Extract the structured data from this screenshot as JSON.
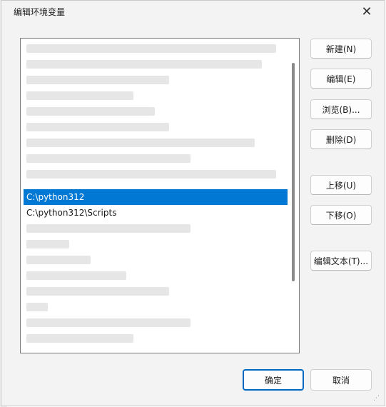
{
  "dialog": {
    "title": "编辑环境变量",
    "close_glyph": "✕"
  },
  "list": {
    "selected_item": "C:\\python312",
    "second_item": "C:\\python312\\Scripts"
  },
  "buttons": {
    "new": "新建(N)",
    "edit": "编辑(E)",
    "browse": "浏览(B)...",
    "delete": "删除(D)",
    "move_up": "上移(U)",
    "move_down": "下移(O)",
    "edit_text": "编辑文本(T)...",
    "ok": "确定",
    "cancel": "取消"
  },
  "colors": {
    "selection": "#0078d4",
    "ok_border": "#0067c0"
  }
}
